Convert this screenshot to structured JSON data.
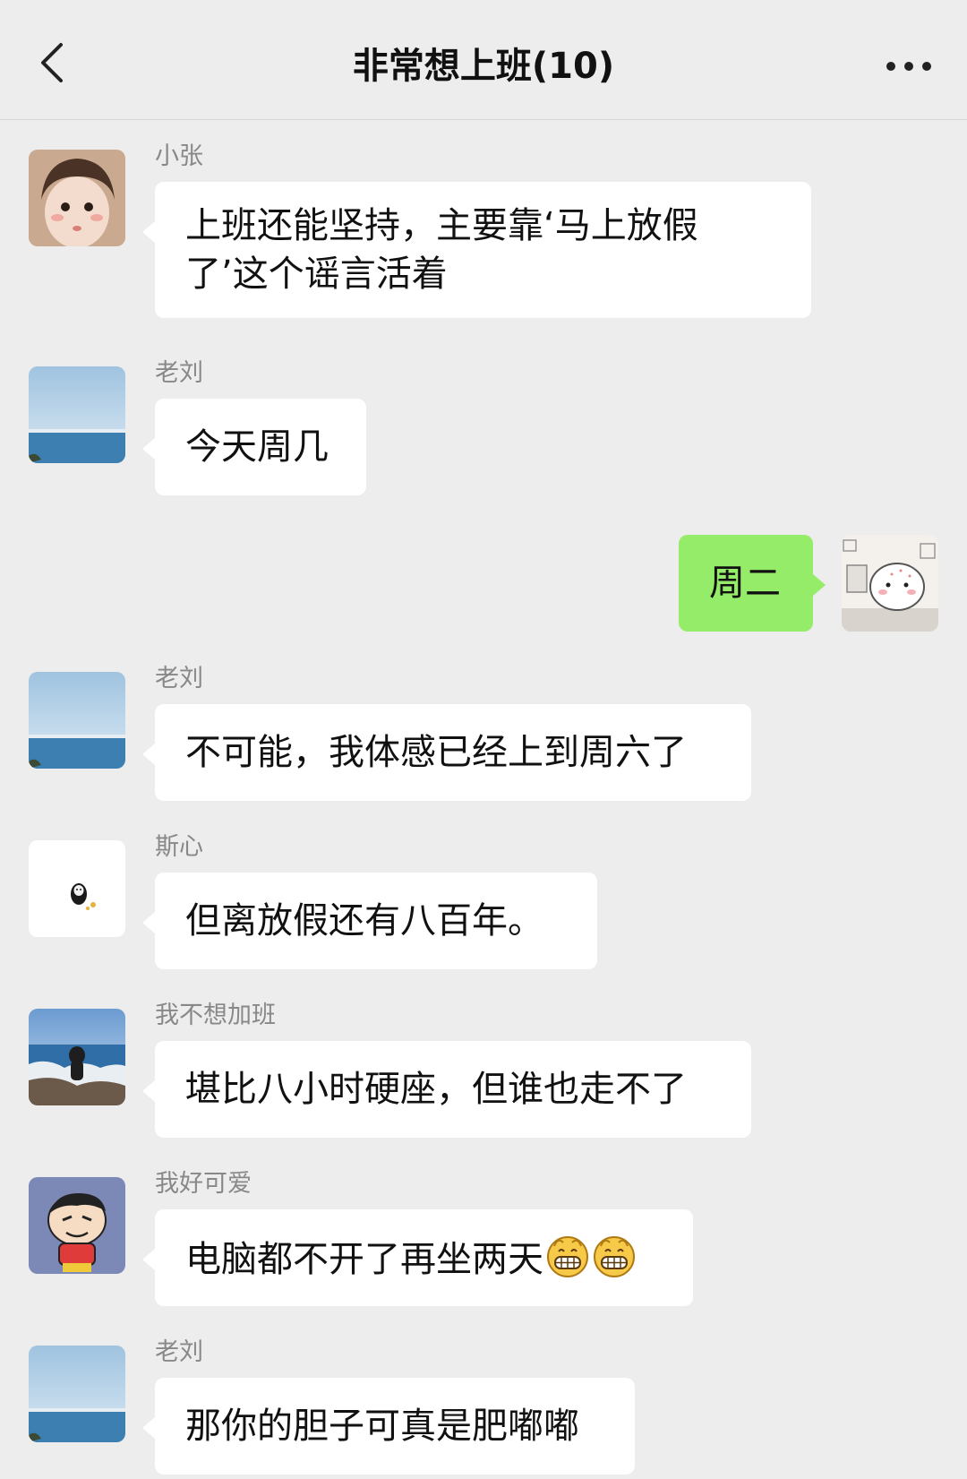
{
  "header": {
    "title": "非常想上班(10)",
    "back_icon": "chevron-left-icon",
    "more_icon": "ellipsis-icon"
  },
  "messages": [
    {
      "sender": "小张",
      "text": "上班还能坚持，主要靠‘马上放假了’这个谣言活着",
      "self": false
    },
    {
      "sender": "老刘",
      "text": "今天周几",
      "self": false
    },
    {
      "sender": "",
      "text": "周二",
      "self": true
    },
    {
      "sender": "老刘",
      "text": "不可能，我体感已经上到周六了",
      "self": false
    },
    {
      "sender": "斯心",
      "text": "但离放假还有八百年。",
      "self": false
    },
    {
      "sender": "我不想加班",
      "text": "堪比八小时硬座，但谁也走不了",
      "self": false
    },
    {
      "sender": "我好可爱",
      "text": "电脑都不开了再坐两天",
      "emoji": [
        "grin-emoji",
        "grin-emoji"
      ],
      "self": false
    },
    {
      "sender": "老刘",
      "text": "那你的胆子可真是肥嘟嘟",
      "self": false
    }
  ],
  "colors": {
    "background": "#ededed",
    "bubble_other": "#ffffff",
    "bubble_self": "#95ec69",
    "sender_name": "#888888"
  }
}
